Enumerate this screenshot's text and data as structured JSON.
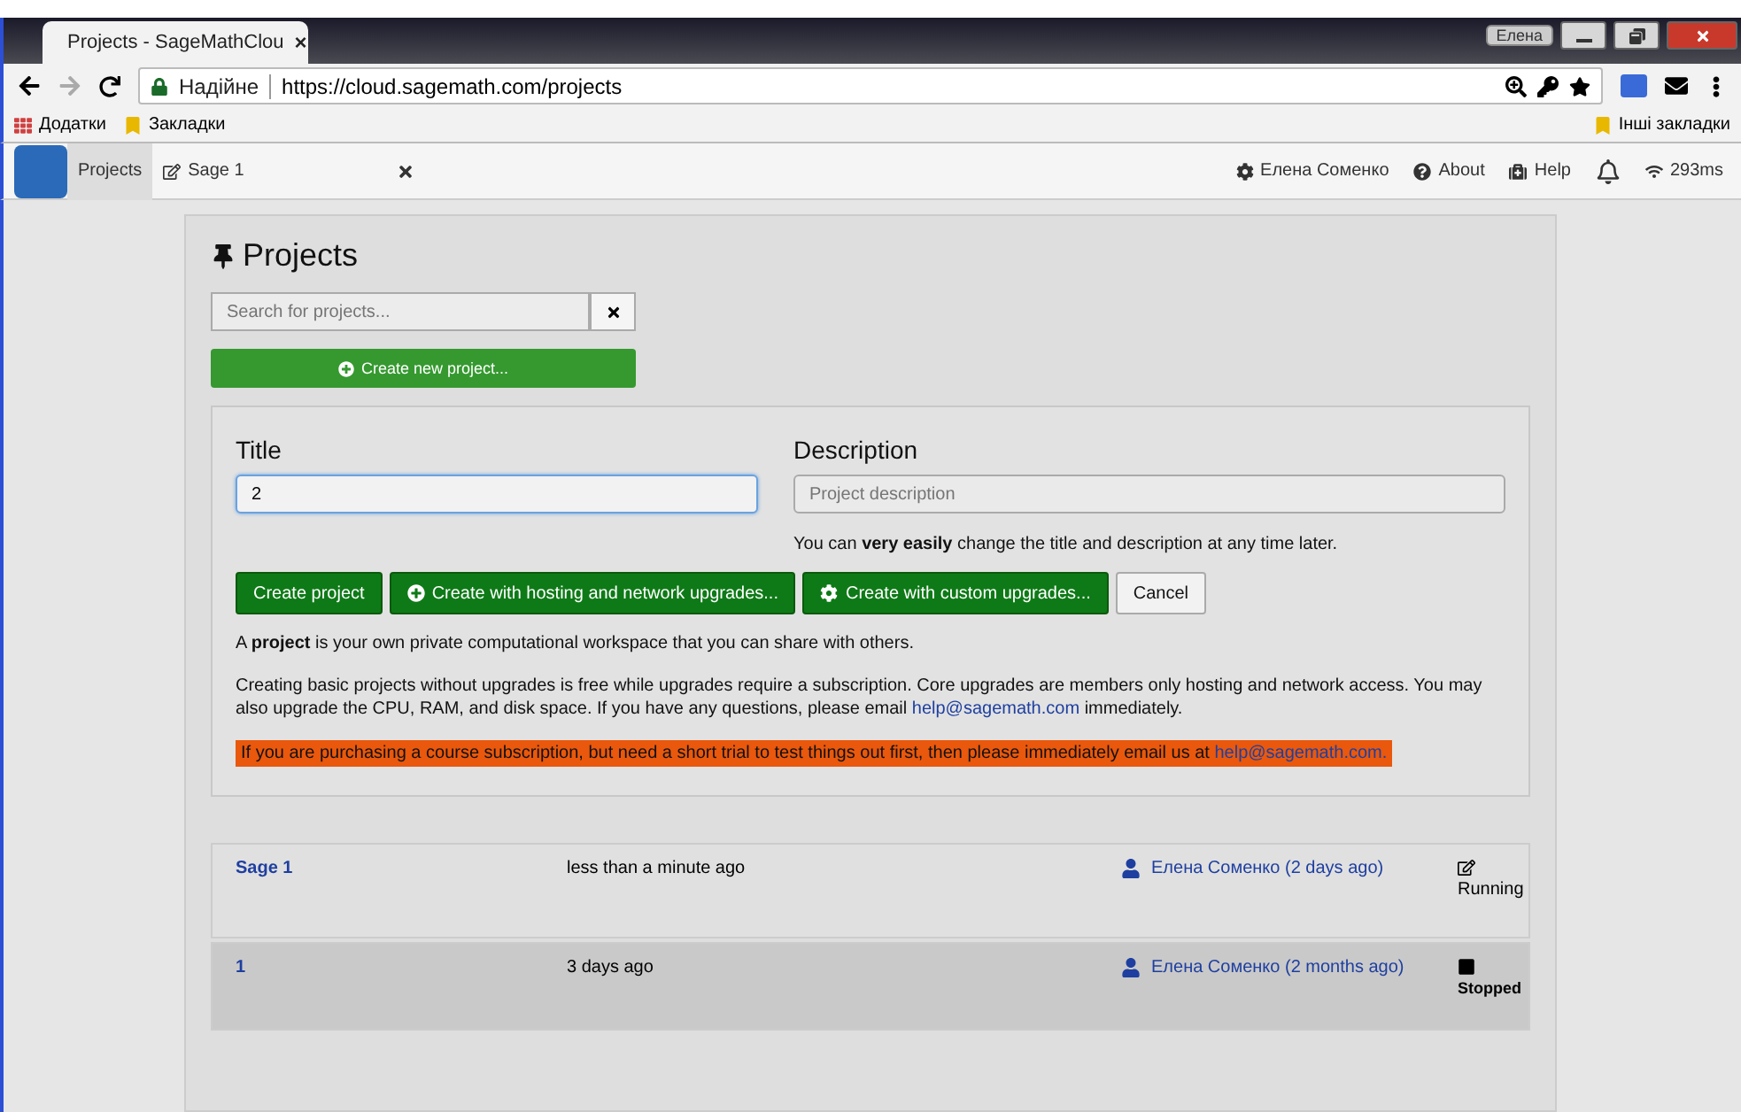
{
  "browser": {
    "tab_title": "Projects - SageMathClou",
    "tab_close": "×",
    "profile": "Елена",
    "security": "Надійне",
    "url": "https://cloud.sagemath.com/projects",
    "bookmarks": [
      "Додатки",
      "Закладки"
    ],
    "other_bookmarks": "Інші закладки"
  },
  "app_nav": {
    "tabs": [
      {
        "label": "Projects",
        "selected": true
      },
      {
        "label": "Sage 1",
        "selected": false
      }
    ],
    "right": [
      {
        "kind": "gear",
        "label": "Елена Соменко"
      },
      {
        "kind": "question",
        "label": "About"
      },
      {
        "kind": "medkit",
        "label": "Help"
      },
      {
        "kind": "bell"
      },
      {
        "kind": "wifi",
        "label": "293ms"
      }
    ]
  },
  "heading": "Projects",
  "search": {
    "placeholder": "Search for projects..."
  },
  "create_new_button": "Create new project...",
  "form": {
    "title_label": "Title",
    "title_value": "2",
    "description_label": "Description",
    "description_placeholder": "Project description",
    "hint": "You can **very easily** change the title and description at any time later.",
    "buttons": [
      {
        "kind": "primary",
        "label": "Create project"
      },
      {
        "kind": "plus",
        "label": "Create with hosting and network upgrades..."
      },
      {
        "kind": "gear",
        "label": "Create with custom upgrades..."
      },
      {
        "kind": "cancel",
        "label": "Cancel"
      }
    ],
    "intro": "A **project** is your own private computational workspace that you can share with others.",
    "upgrades_text": "Creating basic projects without upgrades is free while upgrades require a subscription. Core upgrades are members only hosting and network access. You may also upgrade the CPU, RAM, and disk space. If you have any questions, please email",
    "upgrades_email": "help@sagemath.com",
    "upgrades_tail": "immediately.",
    "warning_text": "If you are purchasing a course subscription, but need a short trial to test things out first, then please immediately email us at",
    "warning_email": "help@sagemath.com."
  },
  "projects": [
    {
      "title": "Sage 1",
      "modified": "less than a minute ago",
      "collaborator": "Елена Соменко (2 days ago)",
      "kind": "running",
      "status": "Running",
      "selected": false
    },
    {
      "title": "1",
      "modified": "3 days ago",
      "collaborator": "Елена Соменко (2 months ago)",
      "kind": "stopped",
      "status": "Stopped",
      "selected": true
    }
  ]
}
